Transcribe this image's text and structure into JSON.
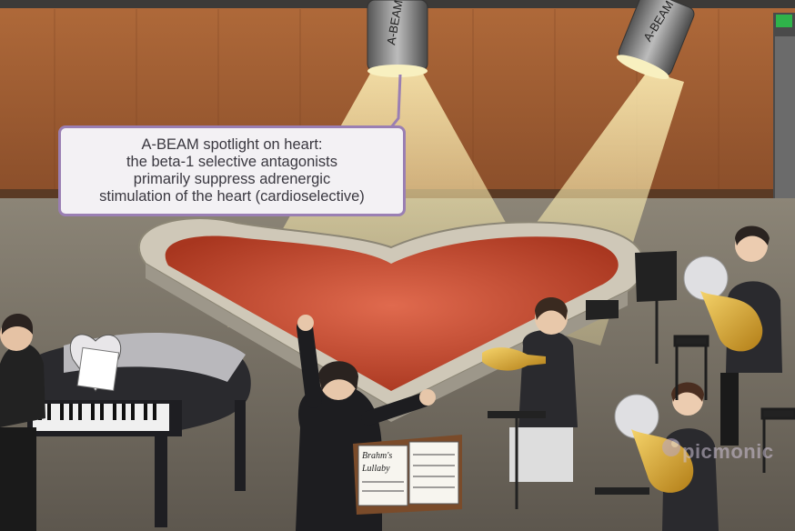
{
  "callout": {
    "lines": [
      "A-BEAM spotlight on heart:",
      "the beta-1 selective antagonists",
      "primarily suppress adrenergic",
      "stimulation of the heart (cardioselective)"
    ]
  },
  "spotlights": {
    "left_label": "A-BEAM",
    "right_label": "A-BEAM"
  },
  "sheet_music": {
    "title_line1": "Brahm's",
    "title_line2": "Lullaby"
  },
  "watermark": "picmonic",
  "colors": {
    "callout_border": "#9a7fb3",
    "heart_red": "#c54a34",
    "spotlight_beam": "#f3e3a0",
    "brass": "#d8a42a"
  },
  "icons": {
    "watermark_logo": "picmonic-brain-logo"
  }
}
